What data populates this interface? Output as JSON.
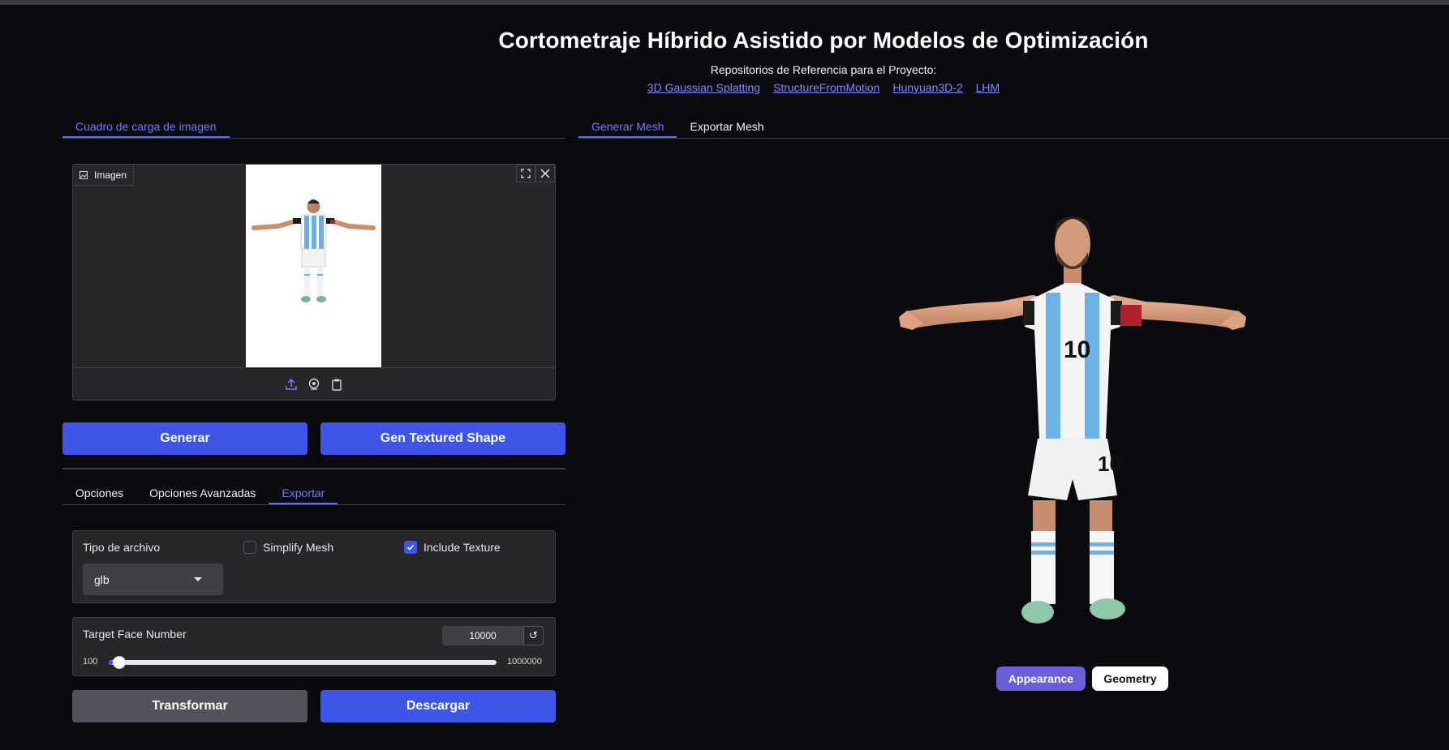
{
  "app": {
    "title": "Cortometraje Híbrido Asistido por Modelos de Optimización",
    "subtitle": "Repositorios de Referencia para el Proyecto:",
    "links": [
      "3D Gaussian Splatting",
      "StructureFromMotion",
      "Hunyuan3D-2",
      "LHM"
    ]
  },
  "left_tabs": [
    {
      "label": "Cuadro de carga de imagen",
      "active": true
    }
  ],
  "right_tabs": [
    {
      "label": "Generar Mesh",
      "active": true
    },
    {
      "label": "Exportar Mesh",
      "active": false
    }
  ],
  "upload": {
    "label": "Imagen",
    "icons": [
      "fullscreen-icon",
      "close-icon",
      "upload-icon",
      "webcam-icon",
      "clipboard-icon"
    ]
  },
  "actions": {
    "generate": "Generar",
    "gen_textured": "Gen Textured Shape"
  },
  "options_tabs": [
    {
      "label": "Opciones",
      "active": false
    },
    {
      "label": "Opciones Avanzadas",
      "active": false
    },
    {
      "label": "Exportar",
      "active": true
    }
  ],
  "export": {
    "file_type_label": "Tipo de archivo",
    "file_type_value": "glb",
    "simplify_label": "Simplify Mesh",
    "simplify_checked": false,
    "texture_label": "Include Texture",
    "texture_checked": true,
    "face_label": "Target Face Number",
    "face_value": "10000",
    "slider_min": "100",
    "slider_max": "1000000",
    "slider_fraction": 0.0099,
    "reset_glyph": "↺",
    "transform_label": "Transformar",
    "download_label": "Descargar"
  },
  "viewer": {
    "appearance_label": "Appearance",
    "geometry_label": "Geometry"
  },
  "colors": {
    "accent": "#3f55e8",
    "tab_active": "#6b7cff",
    "appearance_btn": "#6a5fd8"
  }
}
